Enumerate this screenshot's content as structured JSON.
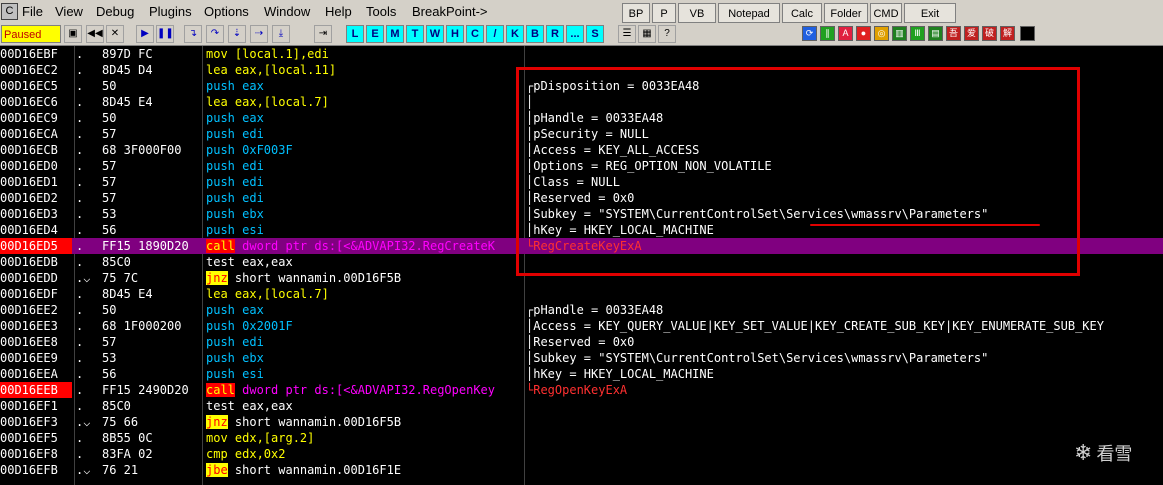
{
  "app": {
    "icon_letter": "C"
  },
  "menu": [
    "File",
    "View",
    "Debug",
    "Plugins",
    "Options",
    "Window",
    "Help",
    "Tools",
    "BreakPoint->"
  ],
  "plugin_buttons": [
    "BP",
    "P",
    "VB",
    "Notepad",
    "Calc",
    "Folder",
    "CMD",
    "Exit"
  ],
  "toolbar": {
    "status": "Paused",
    "letters": [
      "L",
      "E",
      "M",
      "T",
      "W",
      "H",
      "C",
      "/",
      "K",
      "B",
      "R",
      "...",
      "S"
    ]
  },
  "colors": {
    "accent_red": "#e00000",
    "highlight": "#800080",
    "paused_bg": "#ffff00"
  },
  "rows": [
    {
      "addr": "00D16EBF",
      "mark": ".",
      "hex": "897D FC",
      "asm": [
        {
          "t": "mov ",
          "c": "yellow"
        },
        {
          "t": "[local.1]",
          "c": "yellow"
        },
        {
          "t": ",edi",
          "c": "yellow"
        }
      ],
      "cmt": ""
    },
    {
      "addr": "00D16EC2",
      "mark": ".",
      "hex": "8D45 D4",
      "asm": [
        {
          "t": "lea eax,[local.11]",
          "c": "yellow"
        }
      ],
      "cmt": ""
    },
    {
      "addr": "00D16EC5",
      "mark": ".",
      "hex": "50",
      "asm": [
        {
          "t": "push eax",
          "c": "blue"
        }
      ],
      "cmt": "┌pDisposition = 0033EA48"
    },
    {
      "addr": "00D16EC6",
      "mark": ".",
      "hex": "8D45 E4",
      "asm": [
        {
          "t": "lea eax,[local.7]",
          "c": "yellow"
        }
      ],
      "cmt": "│"
    },
    {
      "addr": "00D16EC9",
      "mark": ".",
      "hex": "50",
      "asm": [
        {
          "t": "push eax",
          "c": "blue"
        }
      ],
      "cmt": "│pHandle = 0033EA48"
    },
    {
      "addr": "00D16ECA",
      "mark": ".",
      "hex": "57",
      "asm": [
        {
          "t": "push edi",
          "c": "blue"
        }
      ],
      "cmt": "│pSecurity = NULL"
    },
    {
      "addr": "00D16ECB",
      "mark": ".",
      "hex": "68 3F000F00",
      "asm": [
        {
          "t": "push 0xF003F",
          "c": "blue"
        }
      ],
      "cmt": "│Access = KEY_ALL_ACCESS"
    },
    {
      "addr": "00D16ED0",
      "mark": ".",
      "hex": "57",
      "asm": [
        {
          "t": "push edi",
          "c": "blue"
        }
      ],
      "cmt": "│Options = REG_OPTION_NON_VOLATILE"
    },
    {
      "addr": "00D16ED1",
      "mark": ".",
      "hex": "57",
      "asm": [
        {
          "t": "push edi",
          "c": "blue"
        }
      ],
      "cmt": "│Class = NULL"
    },
    {
      "addr": "00D16ED2",
      "mark": ".",
      "hex": "57",
      "asm": [
        {
          "t": "push edi",
          "c": "blue"
        }
      ],
      "cmt": "│Reserved = 0x0"
    },
    {
      "addr": "00D16ED3",
      "mark": ".",
      "hex": "53",
      "asm": [
        {
          "t": "push ebx",
          "c": "blue"
        }
      ],
      "cmt": "│Subkey = \"SYSTEM\\CurrentControlSet\\Services\\wmassrv\\Parameters\""
    },
    {
      "addr": "00D16ED4",
      "mark": ".",
      "hex": "56",
      "asm": [
        {
          "t": "push esi",
          "c": "blue"
        }
      ],
      "cmt": "│hKey = HKEY_LOCAL_MACHINE"
    },
    {
      "addr": "00D16ED5",
      "mark": ".",
      "hex": "FF15 1890D20",
      "asm": [
        {
          "t": "call",
          "c": "call"
        },
        {
          "t": " dword ptr ds:[<&ADVAPI32.RegCreateK",
          "c": "mag"
        }
      ],
      "cmt": "└RegCreateKeyExA",
      "cmtc": "red",
      "bp": true,
      "hl": true
    },
    {
      "addr": "00D16EDB",
      "mark": ".",
      "hex": "85C0",
      "asm": [
        {
          "t": "test eax,eax",
          "c": "white"
        }
      ],
      "cmt": ""
    },
    {
      "addr": "00D16EDD",
      "mark": ".⌵",
      "hex": "75 7C",
      "asm": [
        {
          "t": "jnz",
          "c": "jmp"
        },
        {
          "t": " short wannamin.00D16F5B",
          "c": "white"
        }
      ],
      "cmt": ""
    },
    {
      "addr": "00D16EDF",
      "mark": ".",
      "hex": "8D45 E4",
      "asm": [
        {
          "t": "lea eax,[local.7]",
          "c": "yellow"
        }
      ],
      "cmt": ""
    },
    {
      "addr": "00D16EE2",
      "mark": ".",
      "hex": "50",
      "asm": [
        {
          "t": "push eax",
          "c": "blue"
        }
      ],
      "cmt": "┌pHandle = 0033EA48"
    },
    {
      "addr": "00D16EE3",
      "mark": ".",
      "hex": "68 1F000200",
      "asm": [
        {
          "t": "push 0x2001F",
          "c": "blue"
        }
      ],
      "cmt": "│Access = KEY_QUERY_VALUE|KEY_SET_VALUE|KEY_CREATE_SUB_KEY|KEY_ENUMERATE_SUB_KEY"
    },
    {
      "addr": "00D16EE8",
      "mark": ".",
      "hex": "57",
      "asm": [
        {
          "t": "push edi",
          "c": "blue"
        }
      ],
      "cmt": "│Reserved = 0x0"
    },
    {
      "addr": "00D16EE9",
      "mark": ".",
      "hex": "53",
      "asm": [
        {
          "t": "push ebx",
          "c": "blue"
        }
      ],
      "cmt": "│Subkey = \"SYSTEM\\CurrentControlSet\\Services\\wmassrv\\Parameters\""
    },
    {
      "addr": "00D16EEA",
      "mark": ".",
      "hex": "56",
      "asm": [
        {
          "t": "push esi",
          "c": "blue"
        }
      ],
      "cmt": "│hKey = HKEY_LOCAL_MACHINE"
    },
    {
      "addr": "00D16EEB",
      "mark": ".",
      "hex": "FF15 2490D20",
      "asm": [
        {
          "t": "call",
          "c": "call"
        },
        {
          "t": " dword ptr ds:[<&ADVAPI32.RegOpenKey",
          "c": "mag"
        }
      ],
      "cmt": "└RegOpenKeyExA",
      "cmtc": "red",
      "bp": true
    },
    {
      "addr": "00D16EF1",
      "mark": ".",
      "hex": "85C0",
      "asm": [
        {
          "t": "test eax,eax",
          "c": "white"
        }
      ],
      "cmt": ""
    },
    {
      "addr": "00D16EF3",
      "mark": ".⌵",
      "hex": "75 66",
      "asm": [
        {
          "t": "jnz",
          "c": "jmp"
        },
        {
          "t": " short wannamin.00D16F5B",
          "c": "white"
        }
      ],
      "cmt": ""
    },
    {
      "addr": "00D16EF5",
      "mark": ".",
      "hex": "8B55 0C",
      "asm": [
        {
          "t": "mov edx,[arg.2]",
          "c": "yellow"
        }
      ],
      "cmt": ""
    },
    {
      "addr": "00D16EF8",
      "mark": ".",
      "hex": "83FA 02",
      "asm": [
        {
          "t": "cmp edx,0x2",
          "c": "yellow"
        }
      ],
      "cmt": ""
    },
    {
      "addr": "00D16EFB",
      "mark": ".⌵",
      "hex": "76 21",
      "asm": [
        {
          "t": "jbe",
          "c": "jmp"
        },
        {
          "t": " short wannamin.00D16F1E",
          "c": "white"
        }
      ],
      "cmt": ""
    }
  ],
  "watermark": {
    "text": "看雪"
  }
}
